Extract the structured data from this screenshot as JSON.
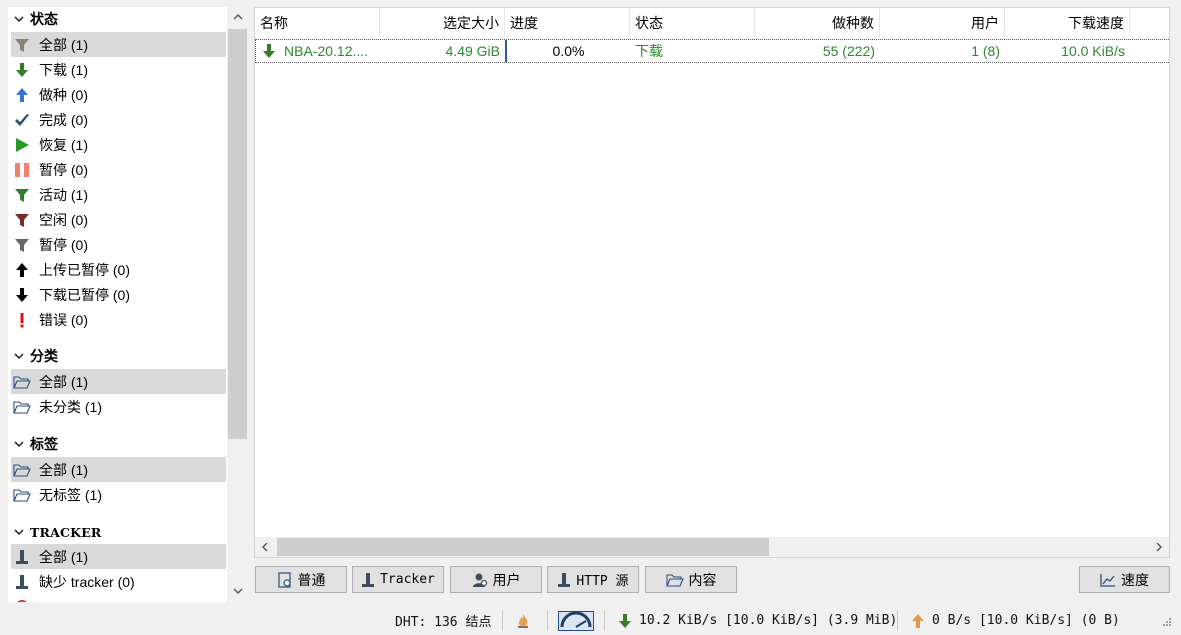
{
  "sidebar": {
    "status": {
      "title": "状态",
      "items": [
        {
          "label": "全部 (1)",
          "icon": "filter-icon"
        },
        {
          "label": "下载 (1)",
          "icon": "download-arrow-icon"
        },
        {
          "label": "做种 (0)",
          "icon": "upload-arrow-icon"
        },
        {
          "label": "完成 (0)",
          "icon": "checkmark-icon"
        },
        {
          "label": "恢复 (1)",
          "icon": "play-icon"
        },
        {
          "label": "暂停 (0)",
          "icon": "pause-icon"
        },
        {
          "label": "活动 (1)",
          "icon": "filter-green-icon"
        },
        {
          "label": "空闲 (0)",
          "icon": "filter-red-icon"
        },
        {
          "label": "暂停 (0)",
          "icon": "filter-gray-icon"
        },
        {
          "label": "上传已暂停 (0)",
          "icon": "up-arrow-black-icon"
        },
        {
          "label": "下载已暂停 (0)",
          "icon": "down-arrow-black-icon"
        },
        {
          "label": "错误 (0)",
          "icon": "exclamation-icon"
        }
      ]
    },
    "category": {
      "title": "分类",
      "items": [
        {
          "label": "全部 (1)",
          "icon": "folder-icon"
        },
        {
          "label": "未分类 (1)",
          "icon": "folder-icon"
        }
      ]
    },
    "tags": {
      "title": "标签",
      "items": [
        {
          "label": "全部 (1)",
          "icon": "folder-icon"
        },
        {
          "label": "无标签 (1)",
          "icon": "folder-icon"
        }
      ]
    },
    "tracker": {
      "title": "TRACKER",
      "items": [
        {
          "label": "全部 (1)",
          "icon": "tracker-server-icon"
        },
        {
          "label": "缺少 tracker (0)",
          "icon": "tracker-server-icon"
        }
      ]
    }
  },
  "table": {
    "columns": [
      "名称",
      "选定大小",
      "进度",
      "状态",
      "做种数",
      "用户",
      "下载速度"
    ],
    "rows": [
      {
        "name": "NBA-20.12....",
        "size": "4.49 GiB",
        "progress_text": "0.0%",
        "progress": 0.0,
        "status": "下载",
        "seeds": "55 (222)",
        "peers": "1 (8)",
        "down_speed": "10.0 KiB/s"
      }
    ]
  },
  "tabs": {
    "general": "普通",
    "trackers": "Tracker",
    "peers": "用户",
    "http": "HTTP 源",
    "content": "内容",
    "speed": "速度"
  },
  "statusbar": {
    "dht": "DHT: 136 结点",
    "download": "10.2 KiB/s [10.0 KiB/s] (3.9 MiB)",
    "upload": "0 B/s [10.0 KiB/s] (0 B)"
  },
  "colors": {
    "downloading_text": "#2b8a2b",
    "selection": "#d9d9d9",
    "progress_border": "#1f5fa8"
  }
}
